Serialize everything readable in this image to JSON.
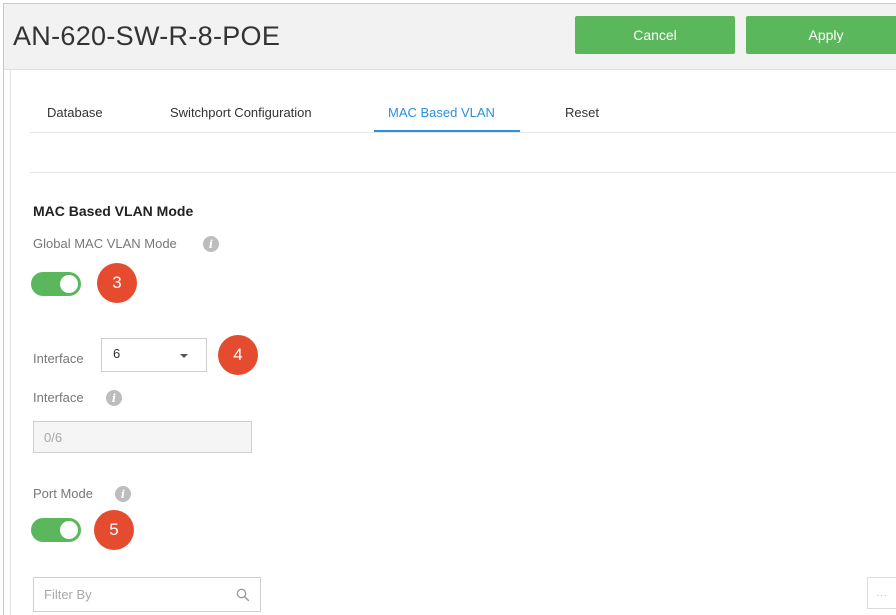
{
  "header": {
    "title": "AN-620-SW-R-8-POE",
    "cancel_label": "Cancel",
    "apply_label": "Apply"
  },
  "tabs": [
    {
      "label": "Database",
      "active": false
    },
    {
      "label": "Switchport Configuration",
      "active": false
    },
    {
      "label": "MAC Based VLAN",
      "active": true
    },
    {
      "label": "Reset",
      "active": false
    }
  ],
  "section": {
    "title": "MAC Based VLAN Mode"
  },
  "global_mode": {
    "label": "Global MAC VLAN Mode",
    "enabled": true,
    "badge": "3"
  },
  "interface_select": {
    "label": "Interface",
    "value": "6",
    "badge": "4"
  },
  "interface_readonly": {
    "label": "Interface",
    "value": "0/6"
  },
  "port_mode": {
    "label": "Port Mode",
    "enabled": true,
    "badge": "5"
  },
  "filter": {
    "placeholder": "Filter By"
  },
  "more_button": {
    "label": "..."
  },
  "icons": {
    "info": "info-icon",
    "search": "search-icon",
    "dropdown": "chevron-down-icon"
  },
  "colors": {
    "accent_green": "#5bb75b",
    "active_tab_blue": "#2b8fdb",
    "badge_red": "#e54b2e"
  }
}
